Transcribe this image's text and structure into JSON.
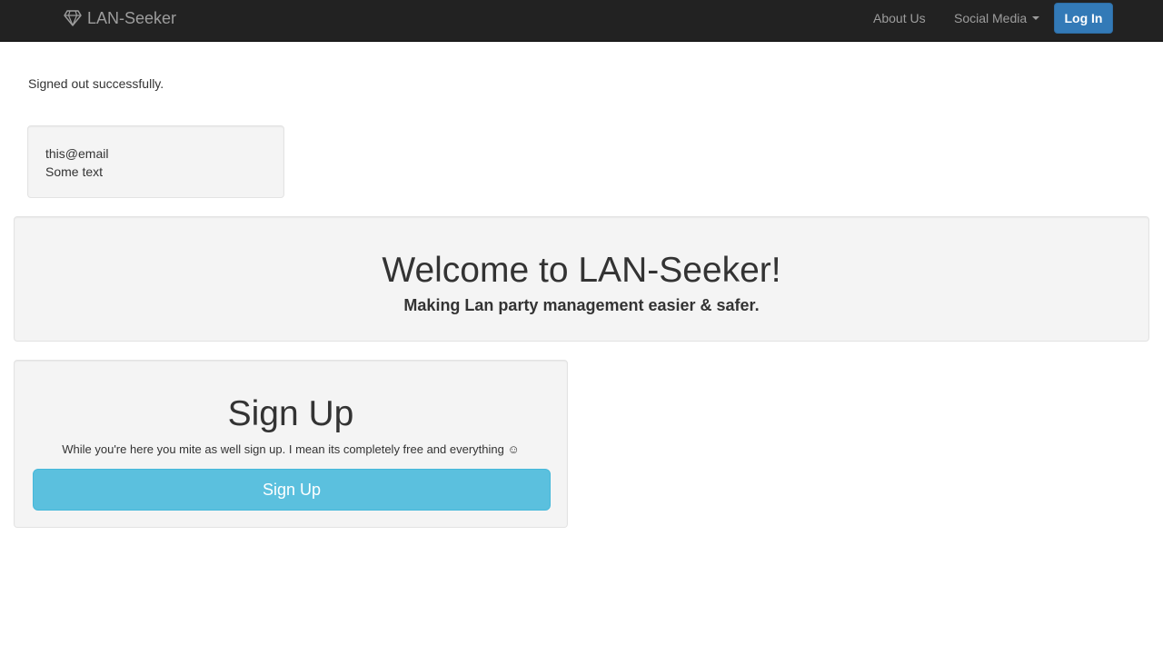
{
  "navbar": {
    "brand": "LAN-Seeker",
    "brand_icon": "diamond-icon",
    "about_label": "About Us",
    "social_label": "Social Media",
    "login_label": "Log In"
  },
  "notice": "Signed out successfully.",
  "user_card": {
    "email": "this@email",
    "text": "Some text"
  },
  "welcome": {
    "title": "Welcome to LAN-Seeker!",
    "subtitle": "Making Lan party management easier & safer."
  },
  "signup": {
    "title": "Sign Up",
    "text": "While you're here you mite as well sign up. I mean its completely free and everything ☺",
    "button_label": "Sign Up"
  },
  "colors": {
    "navbar_bg": "#222222",
    "primary": "#337ab7",
    "info": "#5bc0de",
    "well_bg": "#f4f4f4"
  }
}
